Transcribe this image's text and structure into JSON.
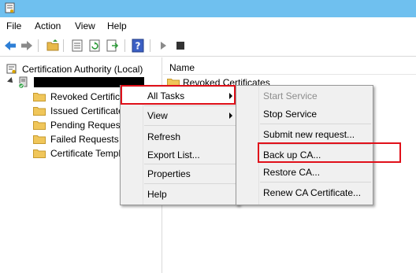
{
  "menubar": {
    "items": [
      "File",
      "Action",
      "View",
      "Help"
    ]
  },
  "toolbar": {
    "buttons": [
      "back-arrow-icon",
      "forward-arrow-icon",
      "up-folder-icon",
      "properties-icon",
      "refresh-icon",
      "export-list-icon",
      "help-icon",
      "start-service-icon",
      "stop-service-icon"
    ]
  },
  "tree": {
    "root_label": "Certification Authority (Local)",
    "folders": [
      "Revoked Certificates",
      "Issued Certificates",
      "Pending Requests",
      "Failed Requests",
      "Certificate Templates"
    ]
  },
  "list": {
    "column_name": "Name",
    "rows": [
      "Revoked Certificates"
    ]
  },
  "context_menu": {
    "items": {
      "all_tasks": "All Tasks",
      "view": "View",
      "refresh": "Refresh",
      "export_list": "Export List...",
      "properties": "Properties",
      "help": "Help"
    }
  },
  "submenu": {
    "items": {
      "start_service": "Start Service",
      "stop_service": "Stop Service",
      "submit_request": "Submit new request...",
      "backup_ca": "Back up CA...",
      "restore_ca": "Restore CA...",
      "renew_ca_certificate": "Renew CA Certificate..."
    }
  },
  "colors": {
    "titlebar": "#6fc0ef",
    "highlight_box": "#e0101a",
    "disabled_text": "#8d8d8d"
  }
}
